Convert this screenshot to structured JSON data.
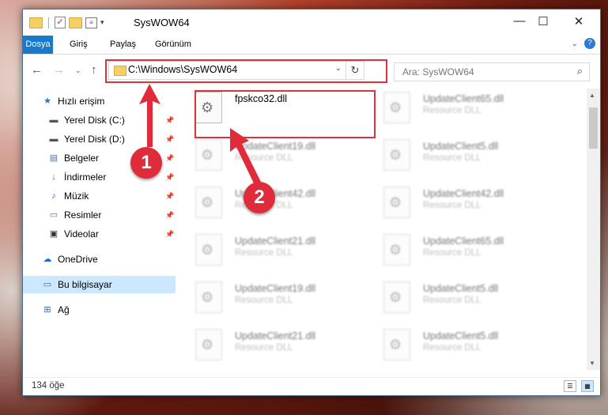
{
  "window": {
    "title": "SysWOW64",
    "controls": {
      "minimize": "—",
      "maximize": "☐",
      "close": "✕"
    }
  },
  "ribbon": {
    "tabs": [
      "Dosya",
      "Giriş",
      "Paylaş",
      "Görünüm"
    ],
    "file_color": "#1979ca"
  },
  "nav": {
    "path": "C:\\Windows\\SysWOW64",
    "search_placeholder": "Ara: SysWOW64"
  },
  "sidebar": {
    "items": [
      {
        "label": "Hızlı erişim",
        "icon": "star-icon"
      },
      {
        "label": "Yerel Disk (C:)",
        "icon": "drive-icon"
      },
      {
        "label": "Yerel Disk (D:)",
        "icon": "drive-icon"
      },
      {
        "label": "Belgeler",
        "icon": "documents-icon"
      },
      {
        "label": "İndirmeler",
        "icon": "download-icon"
      },
      {
        "label": "Müzik",
        "icon": "music-icon"
      },
      {
        "label": "Resimler",
        "icon": "pictures-icon"
      },
      {
        "label": "Videolar",
        "icon": "video-icon"
      },
      {
        "label": "OneDrive",
        "icon": "cloud-icon"
      },
      {
        "label": "Bu bilgisayar",
        "icon": "computer-icon"
      },
      {
        "label": "Ağ",
        "icon": "network-icon"
      }
    ]
  },
  "files": {
    "highlighted": {
      "name": "fpskco32.dll"
    },
    "type_label": "Resource DLL",
    "left_column": [
      "UpdateClient19.dll",
      "UpdateClient42.dll",
      "UpdateClient21.dll",
      "UpdateClient19.dll",
      "UpdateClient21.dll"
    ],
    "right_column": [
      "UpdateClient65.dll",
      "UpdateClient5.dll",
      "UpdateClient42.dll",
      "UpdateClient65.dll",
      "UpdateClient5.dll",
      "UpdateClient5.dll"
    ]
  },
  "status": {
    "count": "134 öğe"
  },
  "markers": {
    "one": "1",
    "two": "2"
  },
  "colors": {
    "highlight_red": "#d8343c",
    "marker_red": "#e02b3a",
    "selected_nav": "#cce8ff"
  }
}
